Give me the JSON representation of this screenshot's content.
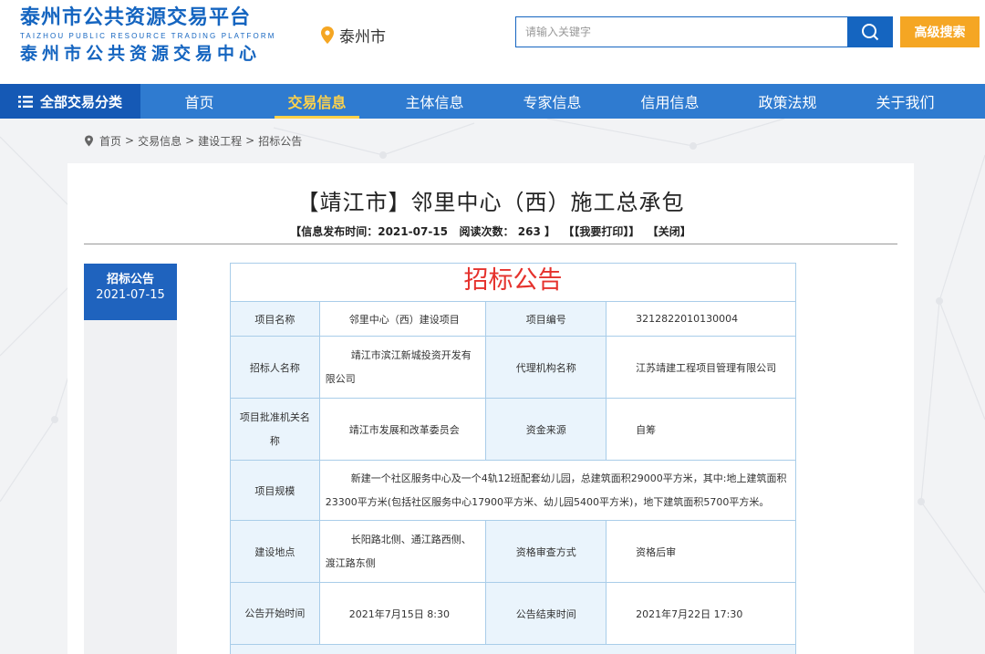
{
  "header": {
    "logo_line1": "泰州市公共资源交易平台",
    "logo_line2": "TAIZHOU PUBLIC RESOURCE TRADING PLATFORM",
    "logo_line3": "泰州市公共资源交易中心",
    "city": "泰州市",
    "search_placeholder": "请输入关键字",
    "advanced_search": "高级搜索"
  },
  "nav": {
    "all_categories": "全部交易分类",
    "items": [
      "首页",
      "交易信息",
      "主体信息",
      "专家信息",
      "信用信息",
      "政策法规",
      "关于我们"
    ],
    "active": "交易信息"
  },
  "breadcrumb": [
    "首页",
    "交易信息",
    "建设工程",
    "招标公告"
  ],
  "article": {
    "title": "【靖江市】邻里中心（西）施工总承包",
    "meta_prefix": "【信息发布时间：",
    "publish_date": "2021-07-15",
    "meta_reads_label": "阅读次数：",
    "reads": "263",
    "meta_suffix": "】",
    "print": "【【我要打印】】",
    "close": "【关闭】"
  },
  "side_tab": {
    "label": "招标公告",
    "date": "2021-07-15"
  },
  "doc": {
    "heading": "招标公告",
    "rows": {
      "project_name_label": "项目名称",
      "project_name": "邻里中心（西）建设项目",
      "project_no_label": "项目编号",
      "project_no": "3212822010130004",
      "tenderer_label": "招标人名称",
      "tenderer": "靖江市滨江新城投资开发有限公司",
      "agency_label": "代理机构名称",
      "agency": "江苏靖建工程项目管理有限公司",
      "approval_label": "项目批准机关名称",
      "approval": "靖江市发展和改革委员会",
      "fund_label": "资金来源",
      "fund": "自筹",
      "scale_label": "项目规模",
      "scale": "新建一个社区服务中心及一个4轨12班配套幼儿园，总建筑面积29000平方米，其中:地上建筑面积23300平方米(包括社区服务中心17900平方米、幼儿园5400平方米)，地下建筑面积5700平方米。",
      "location_label": "建设地点",
      "location": "长阳路北侧、通江路西侧、渡江路东侧",
      "qual_label": "资格审查方式",
      "qual": "资格后审",
      "start_label": "公告开始时间",
      "start": "2021年7月15日 8:30",
      "end_label": "公告结束时间",
      "end": "2021年7月22日 17:30"
    }
  },
  "colors": {
    "brand": "#1565c0",
    "nav": "#2f7bd0",
    "nav_active": "#ffd24a",
    "adv_search": "#f5a623",
    "heading_red": "#e5322d"
  }
}
